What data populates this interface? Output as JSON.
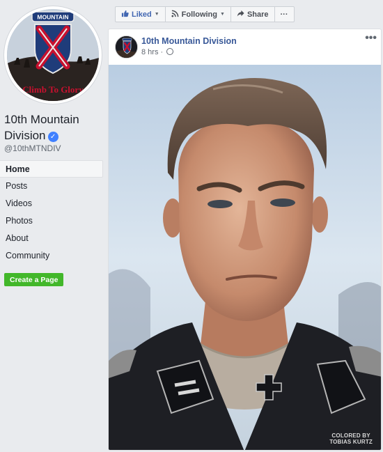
{
  "sidebar": {
    "avatar_text_top": "MOUNTAIN",
    "avatar_text_bottom": "Climb To Glory",
    "page_name": "10th Mountain Division",
    "handle": "@10thMTNDIV",
    "nav": [
      {
        "label": "Home",
        "active": true
      },
      {
        "label": "Posts"
      },
      {
        "label": "Videos"
      },
      {
        "label": "Photos"
      },
      {
        "label": "About"
      },
      {
        "label": "Community"
      }
    ],
    "create_page_label": "Create a Page"
  },
  "actions": {
    "liked_label": "Liked",
    "following_label": "Following",
    "share_label": "Share",
    "more_label": "···"
  },
  "post": {
    "author": "10th Mountain Division",
    "time": "8 hrs",
    "more": "•••",
    "photo_credit_line1": "COLORED BY",
    "photo_credit_line2": "TOBIAS KURTZ"
  },
  "colors": {
    "link": "#385898",
    "accent": "#4267b2",
    "create_button": "#42b72a",
    "verified": "#4080ff",
    "background": "#e9ebee"
  }
}
